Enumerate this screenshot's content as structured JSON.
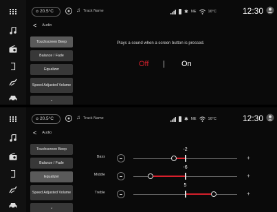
{
  "colors": {
    "accent": "#d8202c",
    "background": "#0a0a0a",
    "button": "#383838",
    "button_active": "#5a5a5a"
  },
  "side_rail": {
    "icons": [
      "apps-grid-icon",
      "music-note-icon",
      "radio-icon",
      "phone-icon",
      "climate-seat-icon",
      "car-icon"
    ]
  },
  "status_bar": {
    "temperature": "20.5°C",
    "track_name": "Track Name",
    "network": "NE",
    "outside_temp": "16°C",
    "clock": "12:30"
  },
  "breadcrumb": {
    "back": "<",
    "title": "Audio"
  },
  "screens": [
    {
      "menu": [
        {
          "label": "Touchscreen Beep",
          "active": true
        },
        {
          "label": "Balance / Fade",
          "active": false
        },
        {
          "label": "Equalizer",
          "active": false
        },
        {
          "label": "Speed Adjusted Volume",
          "active": false
        },
        {
          "label": "⌄",
          "active": false
        }
      ],
      "detail": {
        "description": "Plays a sound when a screen button is pressed.",
        "toggle_off": "Off",
        "toggle_separator": "|",
        "toggle_on": "On",
        "selected": "Off"
      }
    },
    {
      "menu": [
        {
          "label": "Touchscreen Beep",
          "active": false
        },
        {
          "label": "Balance / Fade",
          "active": false
        },
        {
          "label": "Equalizer",
          "active": true
        },
        {
          "label": "Speed Adjusted Volume",
          "active": false
        },
        {
          "label": "⌄",
          "active": false
        }
      ],
      "equalizer": {
        "range": [
          -9,
          9
        ],
        "bands": [
          {
            "name": "Bass",
            "value": -2,
            "value_label": "-2",
            "minus": "−",
            "plus": "+"
          },
          {
            "name": "Middle",
            "value": -6,
            "value_label": "-6",
            "minus": "−",
            "plus": "+"
          },
          {
            "name": "Treble",
            "value": 5,
            "value_label": "5",
            "minus": "−",
            "plus": "+"
          }
        ]
      }
    }
  ]
}
